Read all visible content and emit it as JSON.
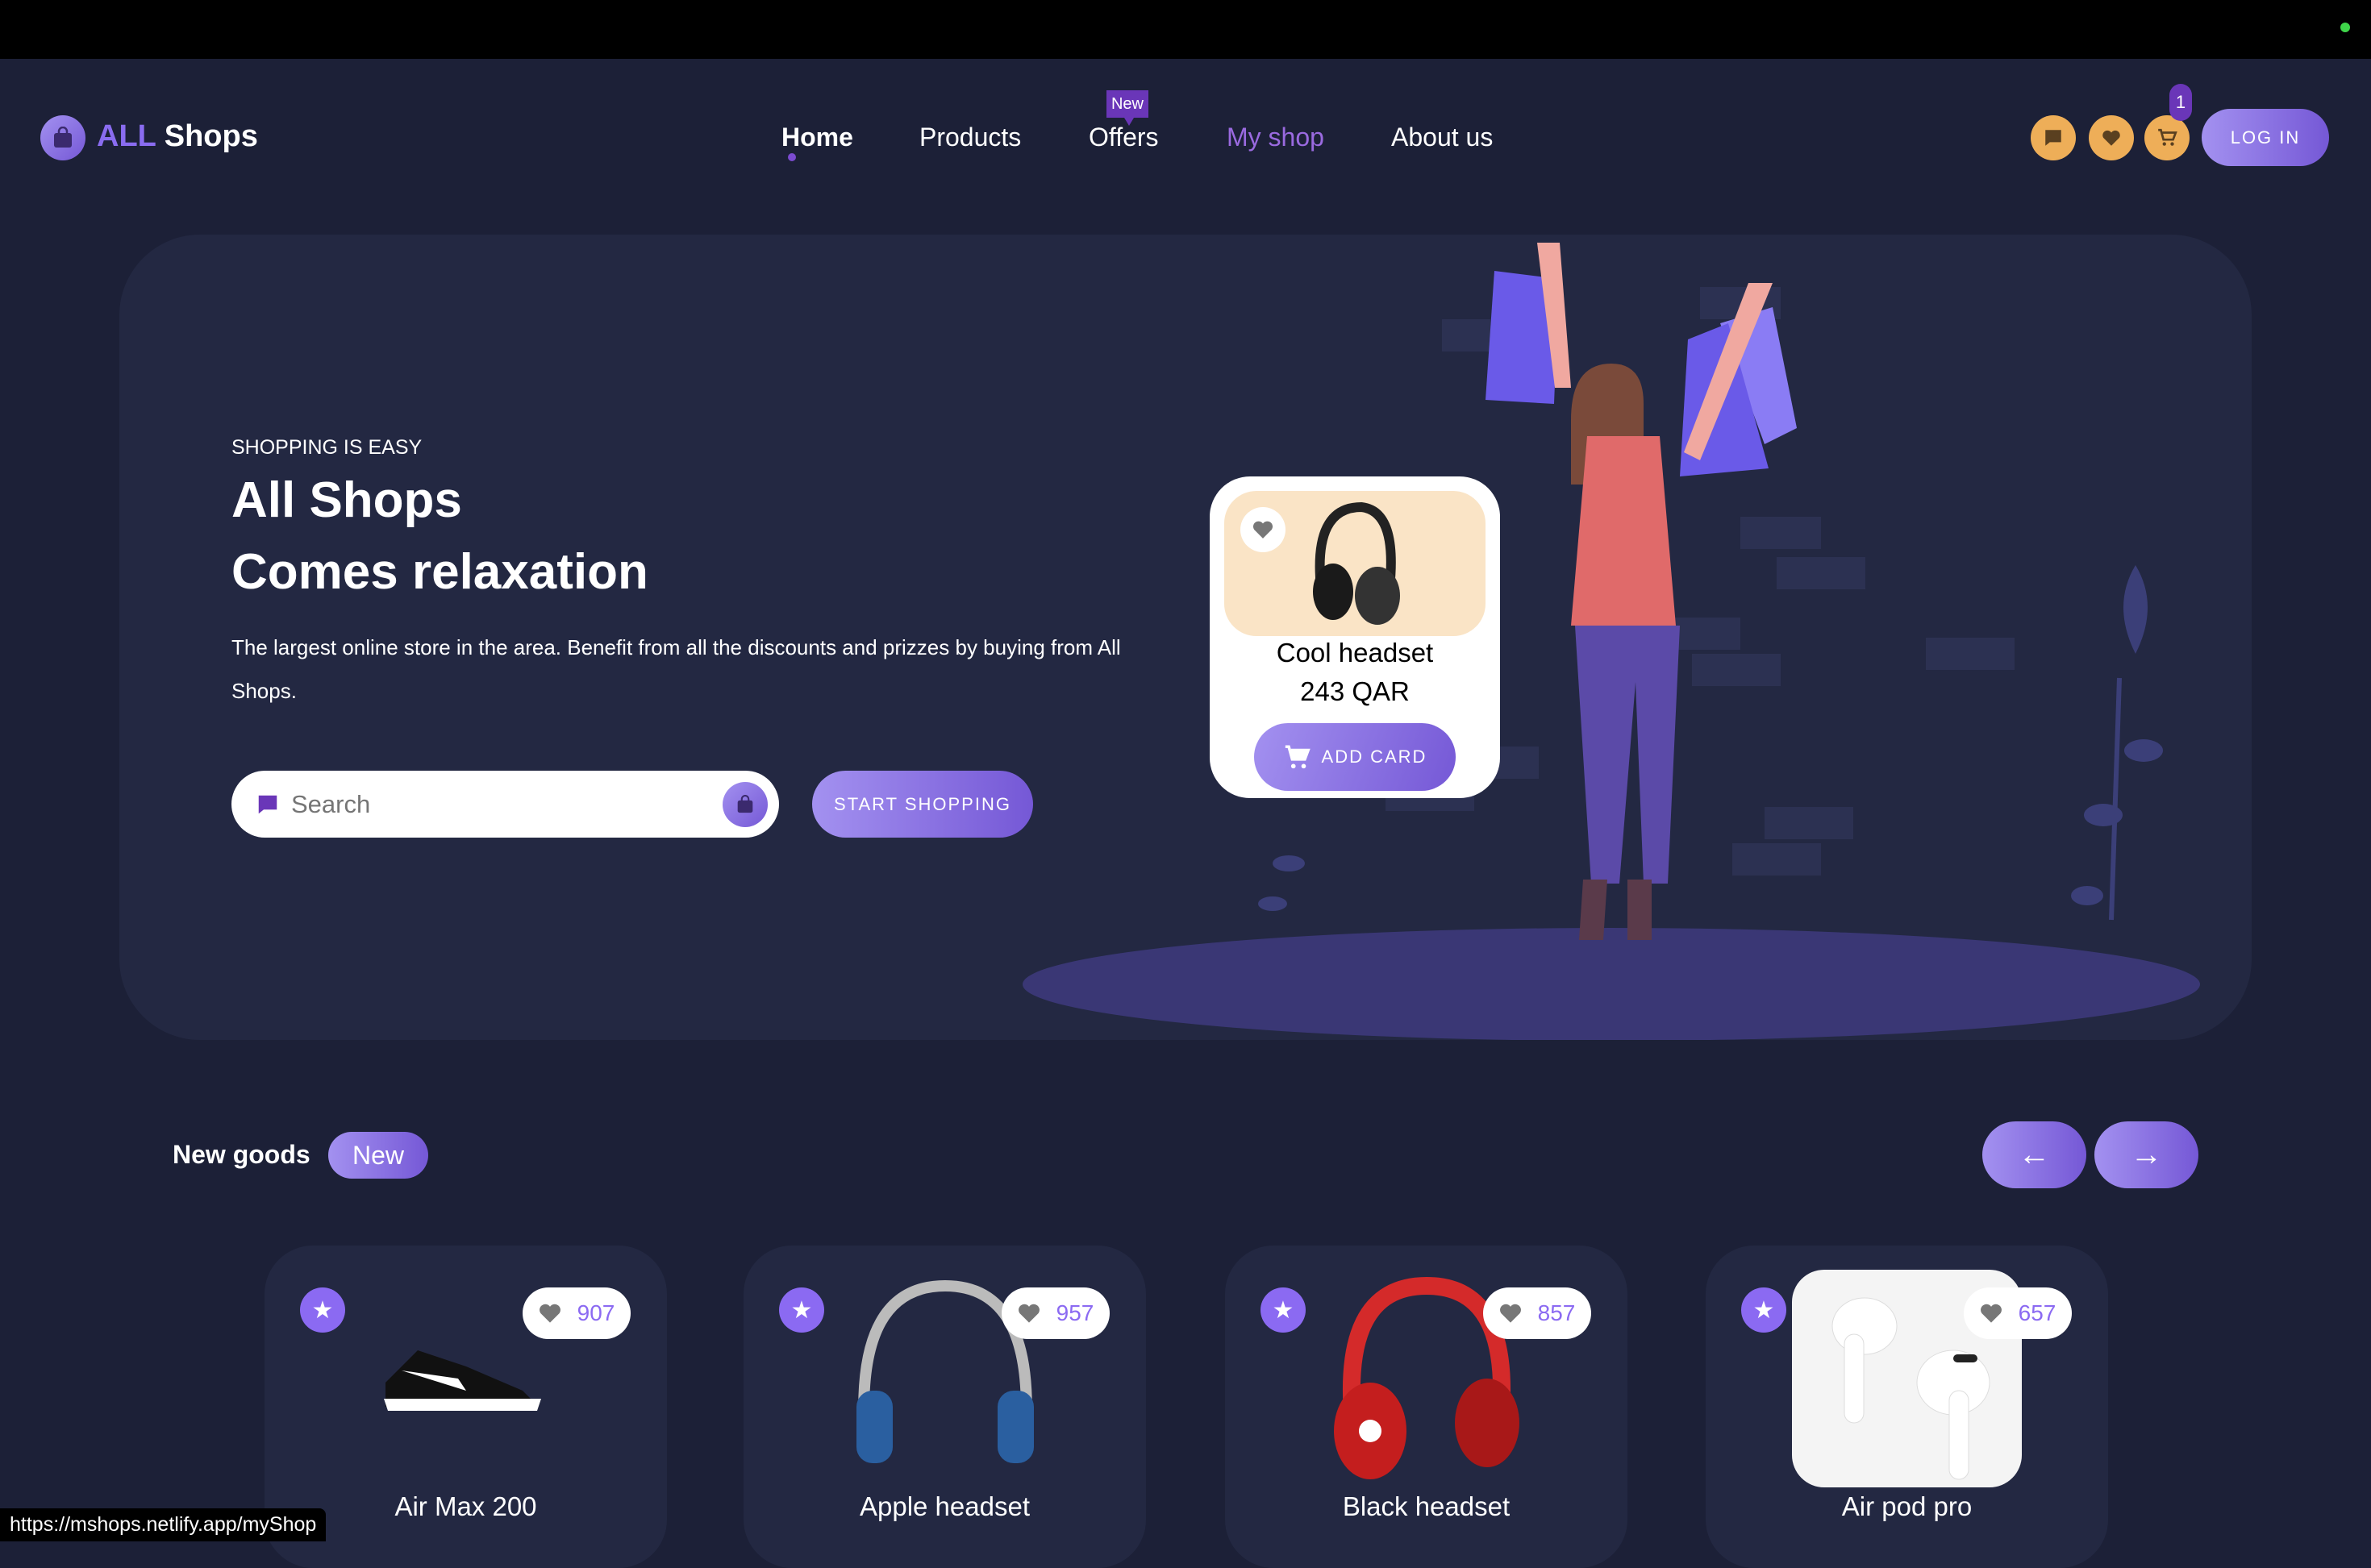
{
  "header": {
    "logo": {
      "accent": "ALL",
      "text": "Shops"
    },
    "nav": [
      {
        "label": "Home",
        "active": true
      },
      {
        "label": "Products"
      },
      {
        "label": "Offers",
        "badge": "New"
      },
      {
        "label": "My shop",
        "highlight": true
      },
      {
        "label": "About us"
      }
    ],
    "icons": [
      "chat-icon",
      "heart-icon",
      "cart-icon"
    ],
    "cart_count": "1",
    "login_label": "LOG IN"
  },
  "hero": {
    "eyebrow": "SHOPPING IS EASY",
    "title_line1": "All Shops",
    "title_line2": "Comes relaxation",
    "description": "The largest online store in the area. Benefit from all the discounts and prizzes by buying from All Shops.",
    "search_placeholder": "Search",
    "start_label": "START SHOPPING",
    "card": {
      "name": "Cool headset",
      "price": "243 QAR",
      "button": "ADD CARD"
    }
  },
  "new_goods": {
    "label": "New goods",
    "pill": "New",
    "products": [
      {
        "name": "Air Max 200",
        "likes": "907"
      },
      {
        "name": "Apple headset",
        "likes": "957"
      },
      {
        "name": "Black headset",
        "likes": "857"
      },
      {
        "name": "Air pod pro",
        "likes": "657"
      }
    ]
  },
  "status_url": "https://mshops.netlify.app/myShop",
  "colors": {
    "accent": "#8b6af2",
    "background": "#1c2037",
    "panel": "#232842",
    "icon_orange": "#eeae58"
  }
}
